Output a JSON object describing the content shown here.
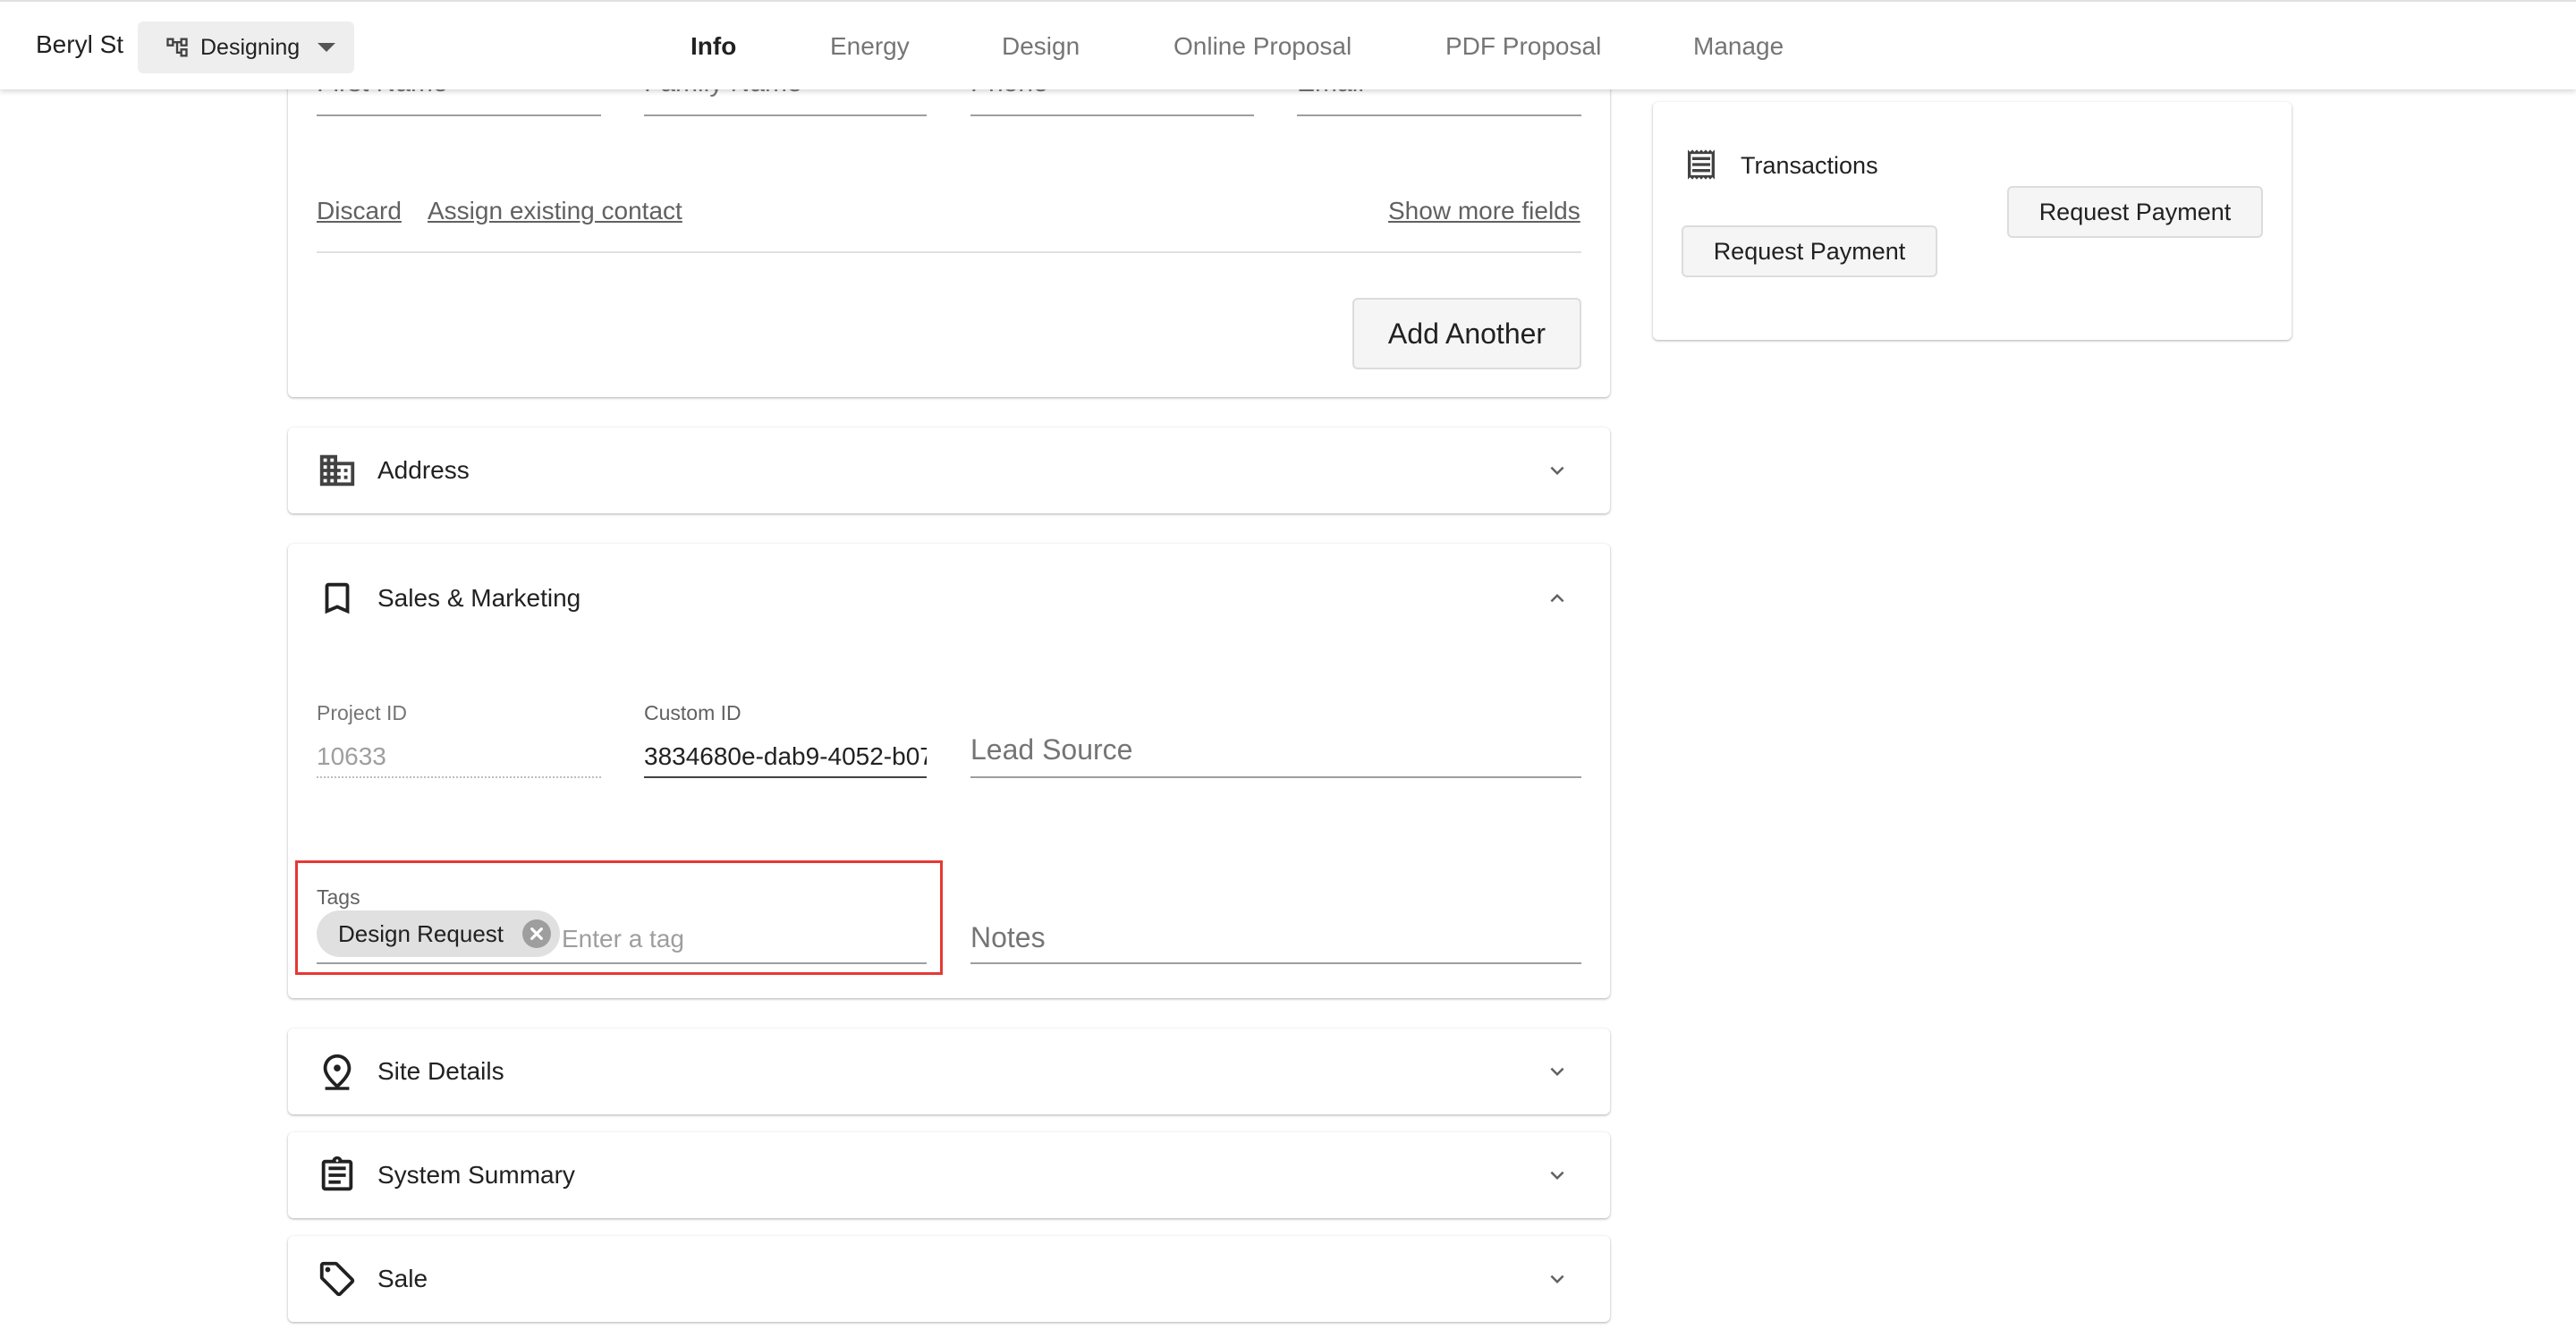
{
  "header": {
    "project_name": "Beryl St",
    "stage_label": "Designing",
    "tabs": [
      "Info",
      "Energy",
      "Design",
      "Online Proposal",
      "PDF Proposal",
      "Manage"
    ],
    "active_tab": "Info"
  },
  "contact": {
    "fields": [
      "First Name",
      "Family Name",
      "Phone",
      "Email"
    ],
    "discard": "Discard",
    "assign_existing": "Assign existing contact",
    "show_more": "Show more fields",
    "add_another": "Add Another"
  },
  "transactions": {
    "title": "Transactions",
    "request_payment_1": "Request Payment",
    "request_payment_2": "Request Payment"
  },
  "sections": {
    "address": "Address",
    "sales_marketing": "Sales & Marketing",
    "site_details": "Site Details",
    "system_summary": "System Summary",
    "sale": "Sale"
  },
  "sales": {
    "project_id_label": "Project ID",
    "project_id_value": "10633",
    "custom_id_label": "Custom ID",
    "custom_id_value": "3834680e-dab9-4052-b07",
    "lead_source_placeholder": "Lead Source",
    "tags_label": "Tags",
    "tag_chip": "Design Request",
    "tag_placeholder": "Enter a tag",
    "notes_placeholder": "Notes"
  },
  "colors": {
    "highlight_box": "#e53935",
    "chip_bg": "#e0e0e0"
  },
  "icons": [
    "tree-icon",
    "caret-down-icon",
    "building-icon",
    "bookmark-icon",
    "location-pin-icon",
    "clipboard-icon",
    "tag-icon",
    "receipt-icon",
    "chevron-down-icon",
    "chevron-up-icon",
    "cancel-icon"
  ]
}
